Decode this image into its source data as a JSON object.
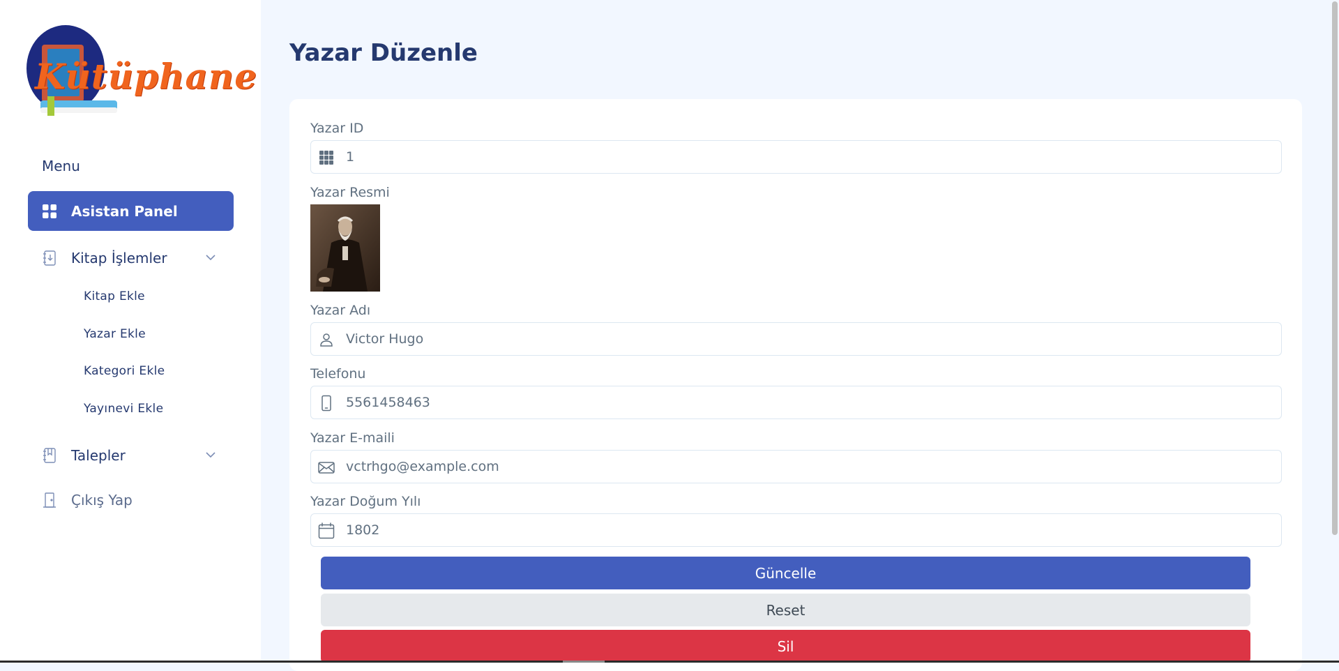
{
  "app": {
    "logo_text": "Kütüphane"
  },
  "sidebar": {
    "menu_title": "Menu",
    "items": [
      {
        "label": "Asistan Panel",
        "icon": "grid-icon",
        "active": true
      },
      {
        "label": "Kitap İşlemler",
        "icon": "journal-arrow-down-icon",
        "has_submenu": true
      },
      {
        "label": "Talepler",
        "icon": "journal-bookmark-icon",
        "has_submenu": true
      },
      {
        "label": "Çıkış Yap",
        "icon": "door-icon"
      }
    ],
    "kitap_submenu": [
      {
        "label": "Kitap Ekle"
      },
      {
        "label": "Yazar Ekle"
      },
      {
        "label": "Kategori Ekle"
      },
      {
        "label": "Yayınevi Ekle"
      }
    ]
  },
  "page": {
    "title": "Yazar Düzenle"
  },
  "form": {
    "author_id": {
      "label": "Yazar ID",
      "value": "1",
      "icon": "grid-3x3-icon"
    },
    "author_photo": {
      "label": "Yazar Resmi"
    },
    "author_name": {
      "label": "Yazar Adı",
      "value": "Victor Hugo",
      "icon": "person-icon"
    },
    "phone": {
      "label": "Telefonu",
      "value": "5561458463",
      "icon": "phone-icon"
    },
    "email": {
      "label": "Yazar E-maili",
      "value": "vctrhgo@example.com",
      "icon": "envelope-icon"
    },
    "birth_year": {
      "label": "Yazar Doğum Yılı",
      "value": "1802",
      "icon": "calendar-icon"
    }
  },
  "buttons": {
    "update": "Güncelle",
    "reset": "Reset",
    "delete": "Sil"
  },
  "colors": {
    "primary": "#435ebe",
    "danger": "#dc3545",
    "light": "#e6e9ec",
    "background": "#f2f7ff",
    "heading": "#25396f"
  }
}
